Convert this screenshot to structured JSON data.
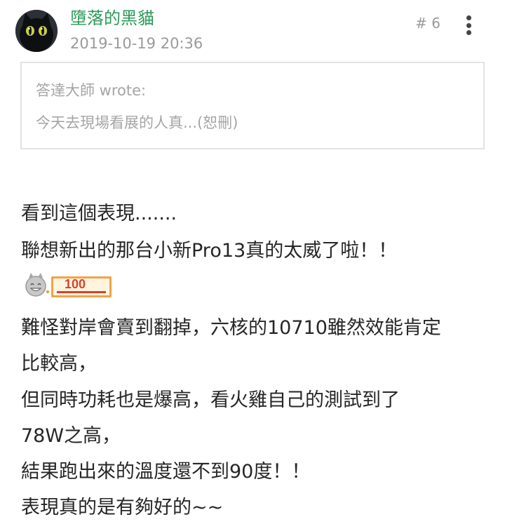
{
  "post": {
    "author": "墮落的黑貓",
    "timestamp": "2019-10-19 20:36",
    "floor": "# 6",
    "quote": {
      "author": "答達大師 wrote:",
      "text": "今天去現場看展的人真...(恕刪)"
    },
    "lines": [
      "看到這個表現.......",
      "聯想新出的那台小新Pro13真的太威了啦！！",
      "難怪對岸會賣到翻掉，六核的10710雖然效能肯定",
      "比較高，",
      "但同時功耗也是爆高，看火雞自己的測試到了",
      "78W之高，",
      "結果跑出來的溫度還不到90度！！",
      "表現真的是有夠好的~~"
    ],
    "sticker": {
      "icon": "grinning-face-100-sticker",
      "label": "100"
    }
  },
  "colors": {
    "author": "#2b9a57",
    "meta": "#9a9a9a",
    "quote_border": "#e3e3e3",
    "sticker_red": "#d9412c",
    "sticker_orange": "#f0a34a"
  }
}
